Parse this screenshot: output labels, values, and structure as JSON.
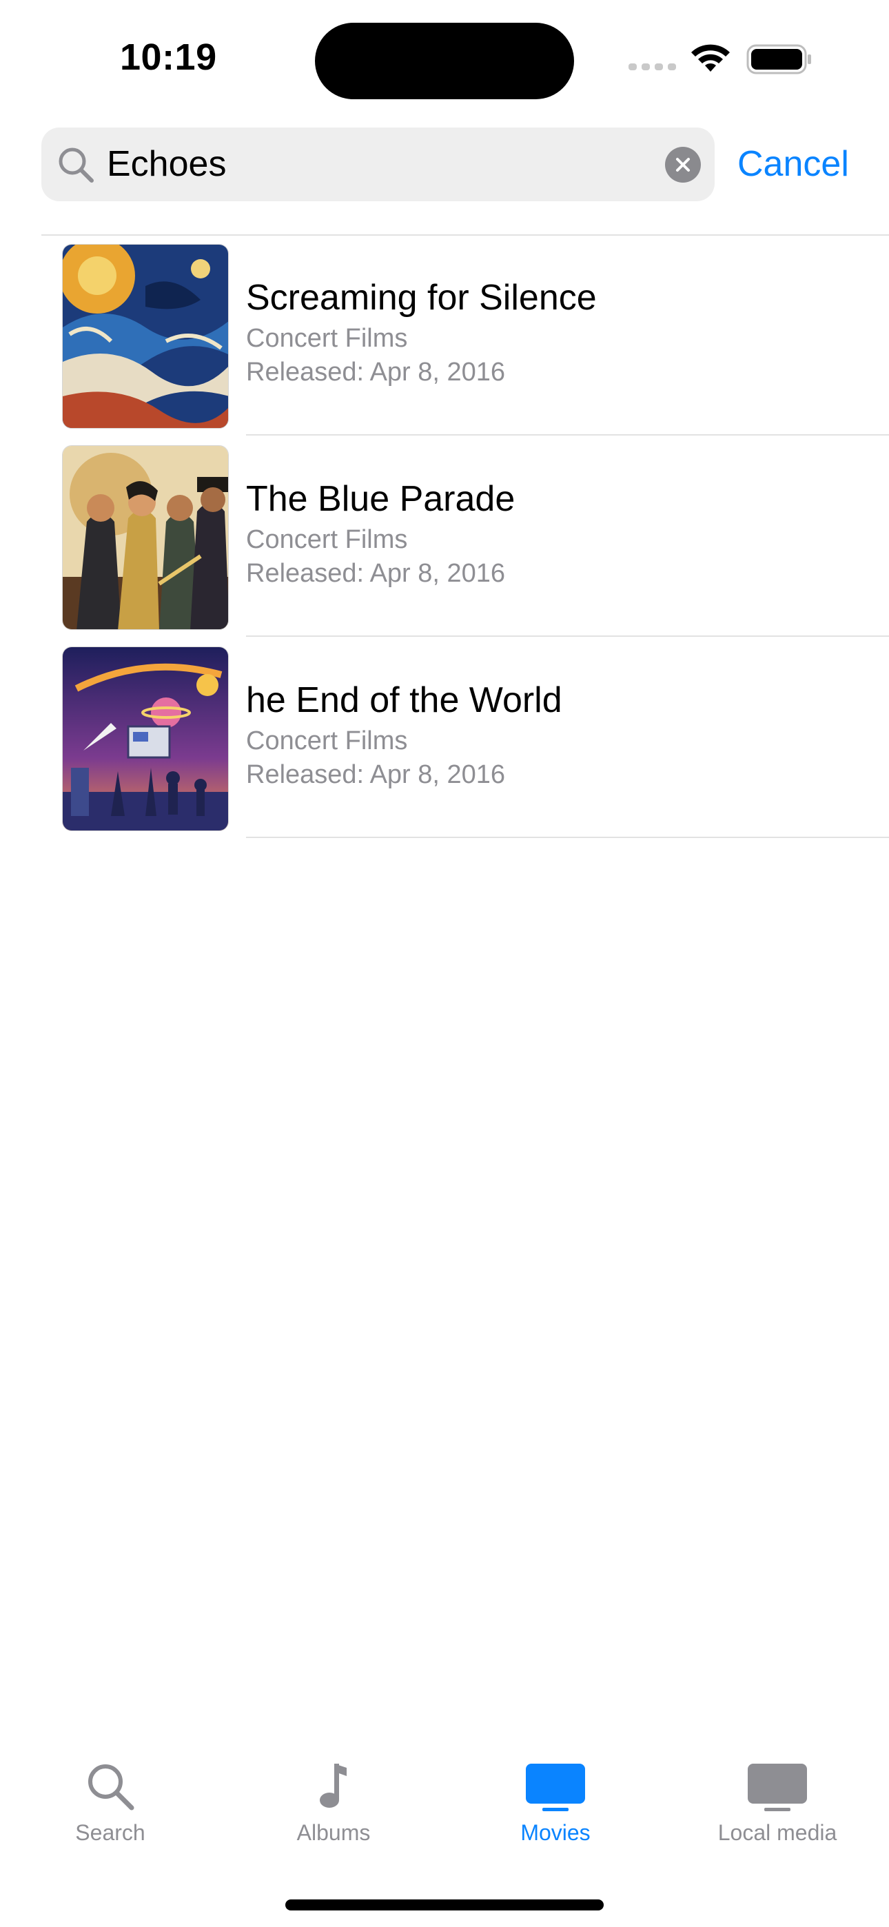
{
  "status_bar": {
    "time": "10:19"
  },
  "search": {
    "value": "Echoes",
    "cancel_label": "Cancel"
  },
  "results": [
    {
      "title": "Screaming for Silence",
      "subtitle": "Concert Films",
      "released": "Released: Apr 8, 2016"
    },
    {
      "title": "The Blue Parade",
      "subtitle": "Concert Films",
      "released": "Released: Apr 8, 2016"
    },
    {
      "title": "he End of the World",
      "subtitle": "Concert Films",
      "released": "Released: Apr 8, 2016"
    }
  ],
  "tab_bar": {
    "items": [
      {
        "label": "Search",
        "icon": "search-icon"
      },
      {
        "label": "Albums",
        "icon": "music-note-icon"
      },
      {
        "label": "Movies",
        "icon": "tv-icon",
        "active": true
      },
      {
        "label": "Local media",
        "icon": "display-icon"
      }
    ]
  },
  "colors": {
    "accent": "#0a84ff",
    "secondary_text": "#8e8e93",
    "field_bg": "#eeeeee"
  }
}
